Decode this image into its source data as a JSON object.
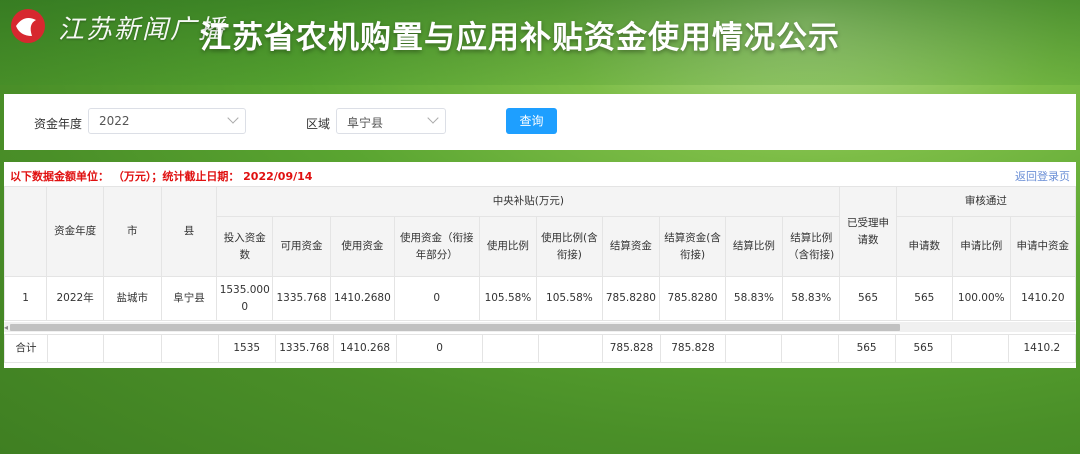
{
  "header": {
    "brand": "江苏新闻广播",
    "title": "江苏省农机购置与应用补贴资金使用情况公示"
  },
  "filters": {
    "year_label": "资金年度",
    "year_value": "2022",
    "region_label": "区域",
    "region_value": "阜宁县",
    "query_label": "查询"
  },
  "notice": {
    "text": "以下数据金额单位： （万元）；统计截止日期： 2022/09/14",
    "back": "返回登录页"
  },
  "table": {
    "headers": {
      "year": "资金年度",
      "city": "市",
      "county": "县",
      "central": "中央补贴(万元)",
      "invest": "投入资金数",
      "available": "可用资金",
      "used": "使用资金",
      "used_part": "使用资金（衔接年部分）",
      "use_ratio": "使用比例",
      "use_ratio_incl": "使用比例(含衔接)",
      "settle": "结算资金",
      "settle_incl": "结算资金(含衔接)",
      "settle_ratio": "结算比例",
      "settle_ratio_incl": "结算比例（含衔接)",
      "accepted": "已受理申请数",
      "review": "审核通过",
      "apply_count": "申请数",
      "apply_ratio": "申请比例",
      "apply_fund": "申请中资金"
    },
    "row": {
      "idx": "1",
      "year": "2022年",
      "city": "盐城市",
      "county": "阜宁县",
      "invest": "1535.0000",
      "available": "1335.768",
      "used": "1410.2680",
      "used_part": "0",
      "use_ratio": "105.58%",
      "use_ratio_incl": "105.58%",
      "settle": "785.8280",
      "settle_incl": "785.8280",
      "settle_ratio": "58.83%",
      "settle_ratio_incl": "58.83%",
      "accepted": "565",
      "apply_count": "565",
      "apply_ratio": "100.00%",
      "apply_fund": "1410.20"
    },
    "total": {
      "label": "合计",
      "invest": "1535",
      "available": "1335.768",
      "used": "1410.268",
      "used_part": "0",
      "settle": "785.828",
      "settle_incl": "785.828",
      "accepted": "565",
      "apply_count": "565",
      "apply_fund": "1410.2"
    }
  },
  "colors": {
    "accent": "#1e9fff",
    "notice": "#e01010",
    "logo": "#d7282f"
  }
}
